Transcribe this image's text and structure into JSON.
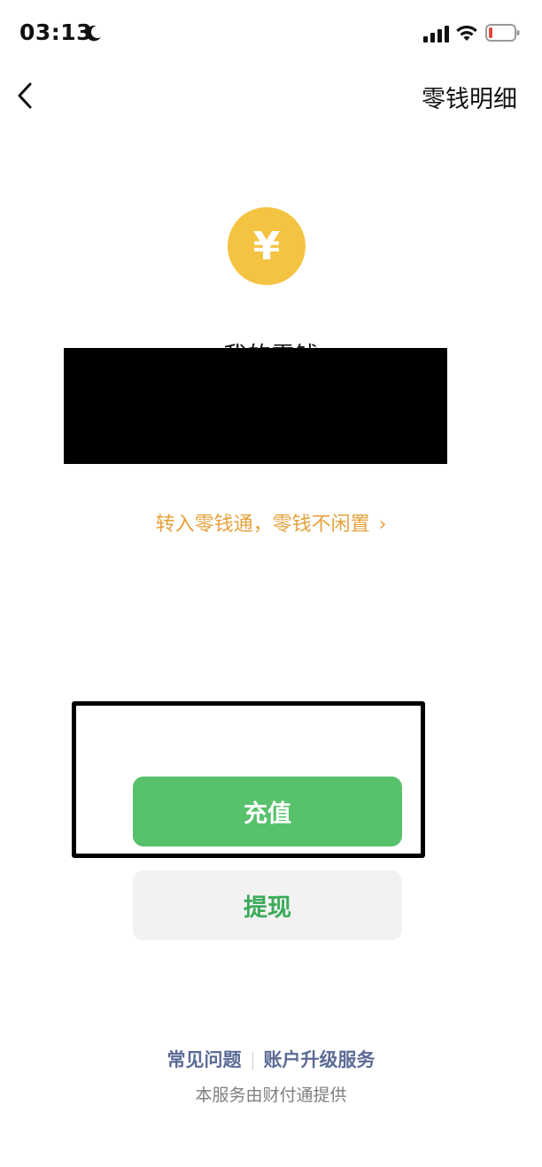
{
  "status_bar": {
    "time": "03:13",
    "icons": [
      "moon-icon",
      "signal-icon",
      "wifi-icon",
      "battery-icon"
    ]
  },
  "nav": {
    "details_label": "零钱明细"
  },
  "wallet": {
    "currency_symbol": "¥",
    "balance_label": "我的零钱",
    "transfer_link": "转入零钱通，零钱不闲置",
    "transfer_chevron": "›"
  },
  "actions": {
    "recharge_label": "充值",
    "withdraw_label": "提现"
  },
  "footer": {
    "faq_label": "常见问题",
    "upgrade_label": "账户升级服务",
    "provider_note": "本服务由财付通提供"
  },
  "colors": {
    "coin": "#f5c342",
    "transfer_link": "#e6a23c",
    "primary_button": "#57c16b",
    "secondary_button_bg": "#f2f2f2",
    "secondary_button_text": "#3cab5a",
    "footer_link": "#5b6b96"
  }
}
